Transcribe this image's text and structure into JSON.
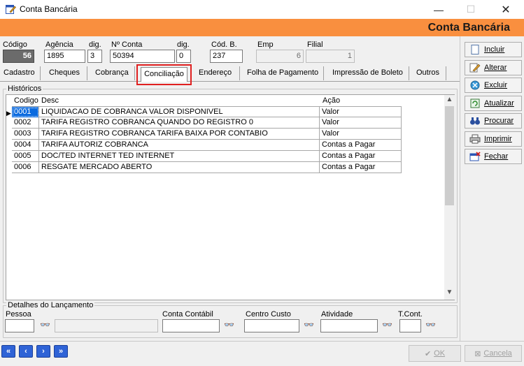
{
  "window": {
    "title": "Conta Bancária",
    "minimize": "—",
    "maximize": "☐",
    "close": "✕"
  },
  "header": {
    "title": "Conta Bancária"
  },
  "account": {
    "codigo_label": "Código",
    "codigo": "56",
    "agencia_label": "Agência",
    "agencia": "1895",
    "dig_label": "dig.",
    "agencia_dig": "3",
    "conta_label": "Nº Conta",
    "conta": "50394",
    "conta_dig_label": "dig.",
    "conta_dig": "0",
    "codb_label": "Cód. B.",
    "codb": "237",
    "emp_label": "Emp",
    "emp": "6",
    "filial_label": "Filial",
    "filial": "1"
  },
  "tabs": [
    "Cadastro",
    "Cheques",
    "Cobrança",
    "Conciliação",
    "Endereço",
    "Folha de Pagamento",
    "Impressão de Boleto",
    "Outros"
  ],
  "active_tab": "Conciliação",
  "historicos": {
    "group_label": "Históricos",
    "columns": {
      "codigo": "Codigo",
      "desc": "Desc",
      "acao": "Ação"
    },
    "rows": [
      {
        "codigo": "0001",
        "desc": "LIQUIDACAO DE COBRANCA VALOR DISPONIVEL",
        "acao": "Valor"
      },
      {
        "codigo": "0002",
        "desc": "TARIFA REGISTRO COBRANCA QUANDO DO REGISTRO     0",
        "acao": "Valor"
      },
      {
        "codigo": "0003",
        "desc": "TARIFA REGISTRO COBRANCA TARIFA BAIXA POR CONTABIO",
        "acao": "Valor"
      },
      {
        "codigo": "0004",
        "desc": "TARIFA AUTORIZ COBRANCA",
        "acao": "Contas a Pagar"
      },
      {
        "codigo": "0005",
        "desc": "DOC/TED INTERNET TED INTERNET",
        "acao": "Contas a Pagar"
      },
      {
        "codigo": "0006",
        "desc": "RESGATE MERCADO ABERTO",
        "acao": "Contas a Pagar"
      }
    ]
  },
  "detalhes": {
    "group_label": "Detalhes do Lançamento",
    "pessoa_label": "Pessoa",
    "conta_contabil_label": "Conta Contábil",
    "centro_custo_label": "Centro Custo",
    "atividade_label": "Atividade",
    "tcont_label": "T.Cont."
  },
  "actions": {
    "incluir": "Incluir",
    "alterar": "Alterar",
    "excluir": "Excluir",
    "atualizar": "Atualizar",
    "procurar": "Procurar",
    "imprimir": "Imprimir",
    "fechar": "Fechar"
  },
  "bottom": {
    "ok": "OK",
    "cancela": "Cancela"
  },
  "colors": {
    "banner": "#f98f3f",
    "active_tab_highlight": "#e02020",
    "nav_buttons": "#2f63d6"
  },
  "icons": [
    "app-icon",
    "find-binoculars-icon",
    "first-icon",
    "prev-icon",
    "next-icon",
    "last-icon"
  ]
}
